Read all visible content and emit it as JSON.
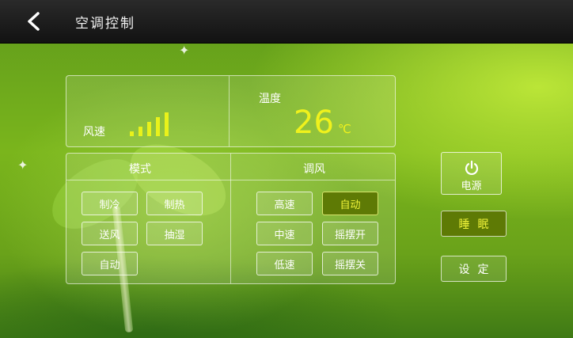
{
  "header": {
    "title": "空调控制",
    "back_icon": "chevron-left-icon"
  },
  "status": {
    "wind_label": "风速",
    "wind_level": 5,
    "wind_level_max": 5,
    "temperature_label": "温度",
    "temperature_value": "26",
    "temperature_unit": "℃"
  },
  "mode": {
    "title": "模式",
    "buttons": [
      "制冷",
      "制热",
      "送风",
      "抽湿",
      "自动"
    ]
  },
  "fan": {
    "title": "调风",
    "buttons": [
      "高速",
      "自动",
      "中速",
      "摇摆开",
      "低速",
      "摇摆关"
    ],
    "selected": "自动"
  },
  "side": {
    "power_label": "电源",
    "power_icon": "power-icon",
    "sleep_label": "睡眠",
    "setting_label": "设定"
  },
  "colors": {
    "accent_yellow": "#f0f21c",
    "active_bg": "#5e7a05",
    "topbar": "#121212"
  }
}
